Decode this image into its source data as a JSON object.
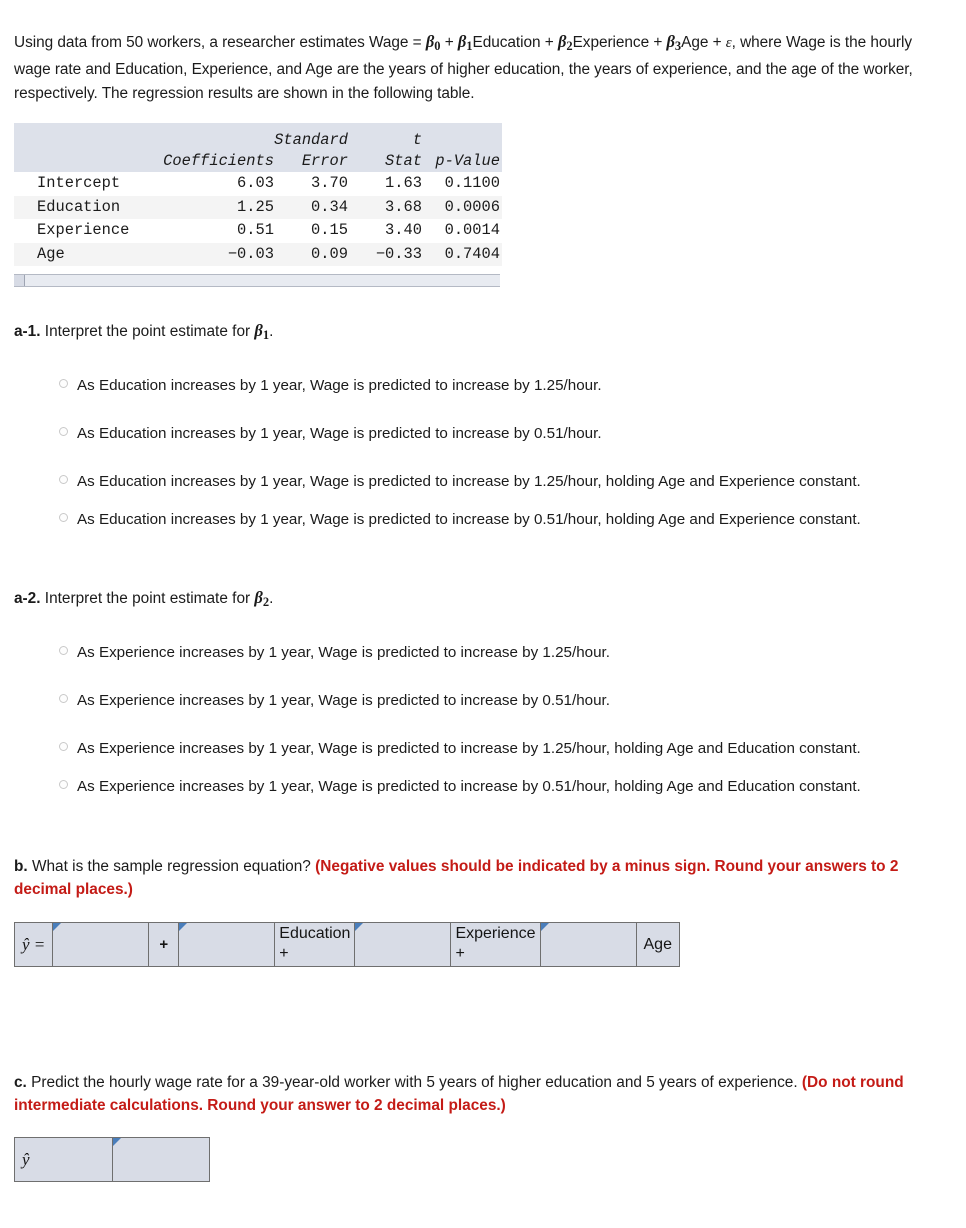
{
  "intro": {
    "part1": "Using data from 50 workers, a researcher estimates Wage = ",
    "b0": "β",
    "b0_sub": "0",
    "plus1": "  +  ",
    "b1": "β",
    "b1_sub": "1",
    "edu": "Education + ",
    "b2": "β",
    "b2_sub": "2",
    "exp": "Experience + ",
    "b3": "β",
    "b3_sub": "3",
    "age": "Age + ",
    "eps": "ε",
    "tail": ", where Wage is the hourly wage rate and Education, Experience, and Age are the years of higher education, the years of experience, and the age of the worker, respectively. The regression results are shown in the following table."
  },
  "reg_table": {
    "header_line1": [
      "",
      "",
      "Standard",
      "t",
      ""
    ],
    "headers": [
      "",
      "Coefficients",
      "Error",
      "Stat",
      "p-Value"
    ],
    "rows": [
      {
        "label": "Intercept",
        "coefficient": "6.03",
        "std_error": "3.70",
        "t_stat": "1.63",
        "p_value": "0.1100"
      },
      {
        "label": "Education",
        "coefficient": "1.25",
        "std_error": "0.34",
        "t_stat": "3.68",
        "p_value": "0.0006"
      },
      {
        "label": "Experience",
        "coefficient": "0.51",
        "std_error": "0.15",
        "t_stat": "3.40",
        "p_value": "0.0014"
      },
      {
        "label": "Age",
        "coefficient": "−0.03",
        "std_error": "0.09",
        "t_stat": "−0.33",
        "p_value": "0.7404"
      }
    ]
  },
  "question_a1": {
    "tag": "a-1.",
    "prompt": " Interpret the point estimate for ",
    "beta": "β",
    "beta_sub": "1",
    "period": ".",
    "options": [
      "As Education increases by 1 year, Wage is predicted to increase by 1.25/hour.",
      "As Education increases by 1 year, Wage is predicted to increase by 0.51/hour.",
      "As Education increases by 1 year, Wage is predicted to increase by 1.25/hour, holding Age and Experience constant.",
      "As Education increases by 1 year, Wage is predicted to increase by 0.51/hour, holding Age and Experience constant."
    ]
  },
  "question_a2": {
    "tag": "a-2.",
    "prompt": " Interpret the point estimate for ",
    "beta": "β",
    "beta_sub": "2",
    "period": ".",
    "options": [
      "As Experience increases by 1 year, Wage is predicted to increase by 1.25/hour.",
      "As Experience increases by 1 year, Wage is predicted to increase by 0.51/hour.",
      "As Experience increases by 1 year, Wage is predicted to increase by 1.25/hour, holding Age and Education constant.",
      "As Experience increases by 1 year, Wage is predicted to increase by 0.51/hour, holding Age and Education constant."
    ]
  },
  "question_b": {
    "tag": "b.",
    "prompt": " What is the sample regression equation? ",
    "instruction": "(Negative values should be indicated by a minus sign. Round your answers to 2 decimal places.)",
    "equation_row": {
      "yhat_label": "ŷ =",
      "intercept_value": "",
      "op1": "+",
      "education_value": "",
      "education_label": "Education\n+",
      "experience_value": "",
      "experience_label": "Experience\n+",
      "age_value": "",
      "age_label": "Age"
    }
  },
  "question_c": {
    "tag": "c.",
    "prompt": " Predict the hourly wage rate for a 39-year-old worker with 5 years of higher education and 5 years of experience. ",
    "instruction": "(Do not round intermediate calculations. Round your answer to 2 decimal places.)",
    "answer_row": {
      "yhat_label": "ŷ",
      "value": ""
    }
  },
  "colors": {
    "red_instruction": "#c41b16",
    "table_header_bg": "#dde1ea",
    "table_alt_row_bg": "#f4f4f4",
    "input_cell_bg": "#d8dce6",
    "flag_marker": "#4a7ebb"
  }
}
